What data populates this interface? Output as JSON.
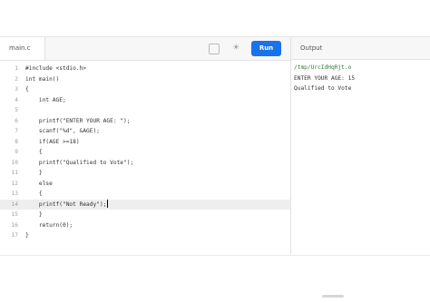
{
  "editor": {
    "file_tab": "main.c",
    "fullscreen_icon": "fullscreen-icon",
    "theme_icon": "theme-toggle-icon",
    "run_label": "Run"
  },
  "output": {
    "header": "Output",
    "lines": [
      "/tmp/UrcIdHqRjt.o",
      "ENTER YOUR AGE: 15",
      "Qualified to Vote"
    ]
  },
  "code_lines": [
    {
      "n": "1",
      "text": "#include <stdio.h>"
    },
    {
      "n": "2",
      "text": "int main()"
    },
    {
      "n": "3",
      "text": "{"
    },
    {
      "n": "4",
      "text": "    int AGE;"
    },
    {
      "n": "5",
      "text": ""
    },
    {
      "n": "6",
      "text": "    printf(\"ENTER YOUR AGE: \");"
    },
    {
      "n": "7",
      "text": "    scanf(\"%d\", &AGE);"
    },
    {
      "n": "8",
      "text": "    if(AGE >=18)"
    },
    {
      "n": "9",
      "text": "    {"
    },
    {
      "n": "10",
      "text": "    printf(\"Qualified to Vote\");"
    },
    {
      "n": "11",
      "text": "    }"
    },
    {
      "n": "12",
      "text": "    else"
    },
    {
      "n": "13",
      "text": "    {"
    },
    {
      "n": "14",
      "text": "    printf(\"Not Ready\");"
    },
    {
      "n": "15",
      "text": "    }"
    },
    {
      "n": "16",
      "text": "    return(0);"
    },
    {
      "n": "17",
      "text": "}"
    }
  ],
  "active_line": 14
}
